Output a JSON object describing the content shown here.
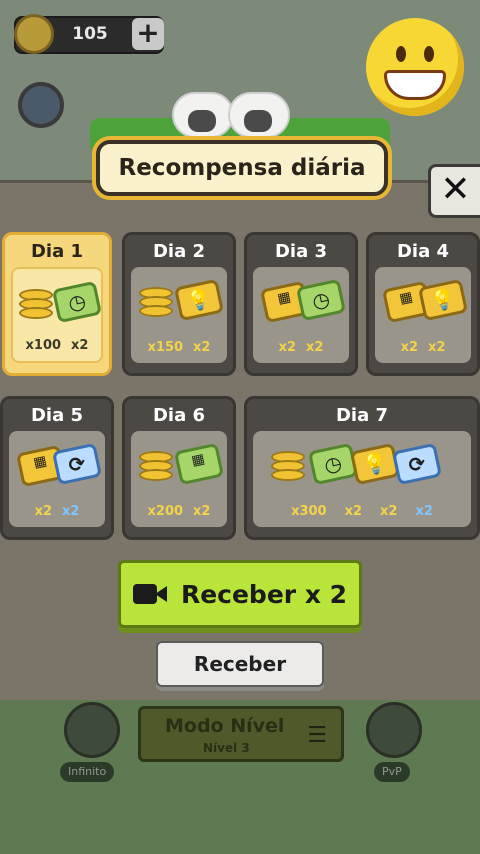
{
  "hud": {
    "coins": "105",
    "plus": "+"
  },
  "title": "Recompensa diária",
  "close": "✕",
  "days": [
    {
      "label": "Dia 1",
      "rewards": [
        "x100",
        "x2"
      ]
    },
    {
      "label": "Dia 2",
      "rewards": [
        "x150",
        "x2"
      ]
    },
    {
      "label": "Dia 3",
      "rewards": [
        "x2",
        "x2"
      ]
    },
    {
      "label": "Dia 4",
      "rewards": [
        "x2",
        "x2"
      ]
    },
    {
      "label": "Dia 5",
      "rewards": [
        "x2",
        "x2"
      ]
    },
    {
      "label": "Dia 6",
      "rewards": [
        "x200",
        "x2"
      ]
    },
    {
      "label": "Dia 7",
      "rewards": [
        "x300",
        "x2",
        "x2",
        "x2"
      ]
    }
  ],
  "buttons": {
    "receive_ad": "Receber x 2",
    "receive": "Receber"
  },
  "bottom": {
    "mode_title": "Modo Nível",
    "mode_sub": "Nível 3",
    "left_label": "Infinito",
    "right_label": "PvP"
  },
  "colors": {
    "accent_green": "#b9e43a",
    "active_card": "#f6d77c",
    "gold": "#f1c232"
  }
}
